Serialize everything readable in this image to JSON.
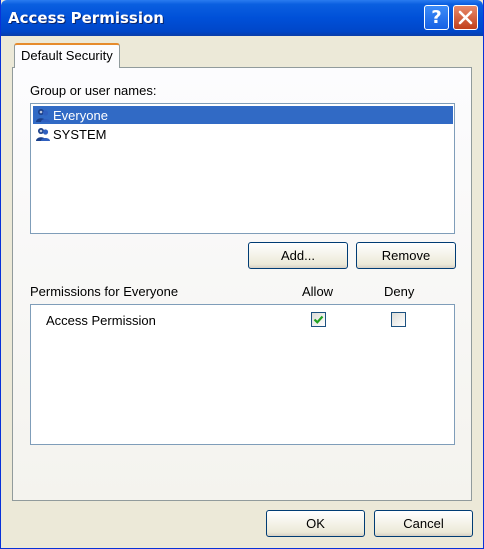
{
  "window": {
    "title": "Access Permission",
    "help_icon": "question-mark-icon",
    "close_icon": "close-x-icon"
  },
  "tabs": [
    {
      "label": "Default Security"
    }
  ],
  "groups": {
    "label": "Group or user names:",
    "items": [
      {
        "name": "Everyone",
        "icon": "user-group-icon",
        "selected": true
      },
      {
        "name": "SYSTEM",
        "icon": "user-group-icon",
        "selected": false
      }
    ],
    "add_label": "Add...",
    "remove_label": "Remove"
  },
  "permissions": {
    "label": "Permissions for Everyone",
    "allow_header": "Allow",
    "deny_header": "Deny",
    "rows": [
      {
        "name": "Access Permission",
        "allow": true,
        "deny": false
      }
    ]
  },
  "footer": {
    "ok_label": "OK",
    "cancel_label": "Cancel"
  },
  "colors": {
    "titlebar": "#0050d8",
    "selection": "#316ac5",
    "check": "#21a121"
  }
}
